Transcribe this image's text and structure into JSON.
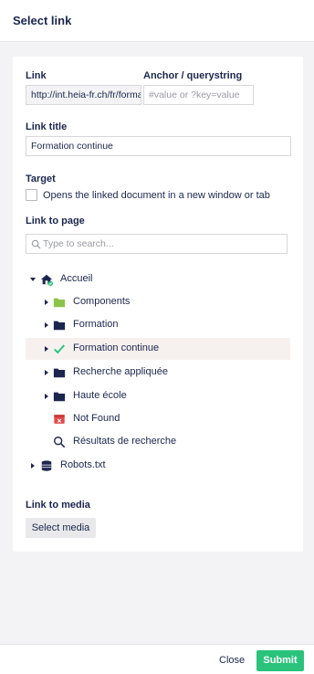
{
  "header": {
    "title": "Select link"
  },
  "link": {
    "label": "Link",
    "value": "http://int.heia-fr.ch/fr/formation-continue/"
  },
  "anchor": {
    "label": "Anchor / querystring",
    "placeholder": "#value or ?key=value"
  },
  "link_title": {
    "label": "Link title",
    "value": "Formation continue"
  },
  "target": {
    "label": "Target",
    "checkbox_label": "Opens the linked document in a new window or tab"
  },
  "link_to_page": {
    "label": "Link to page",
    "search_placeholder": "Type to search..."
  },
  "tree": {
    "root": {
      "label": "Accueil",
      "icon": "home-icon"
    },
    "children": [
      {
        "label": "Components",
        "icon": "folder-icon"
      },
      {
        "label": "Formation",
        "icon": "folder-icon"
      },
      {
        "label": "Formation continue",
        "icon": "check-icon"
      },
      {
        "label": "Recherche appliquée",
        "icon": "folder-icon"
      },
      {
        "label": "Haute école",
        "icon": "folder-icon"
      },
      {
        "label": "Not Found",
        "icon": "error-page-icon"
      },
      {
        "label": "Résultats de recherche",
        "icon": "search-icon"
      }
    ],
    "robots": {
      "label": "Robots.txt",
      "icon": "robot-icon"
    }
  },
  "link_to_media": {
    "label": "Link to media",
    "button": "Select media"
  },
  "footer": {
    "close": "Close",
    "submit": "Submit"
  },
  "colors": {
    "text": "#1b264f",
    "accent_green": "#2bc37c",
    "folder_green": "#8cc34b",
    "not_found_red": "#e44b4b",
    "active_row": "#f6f1ef"
  }
}
